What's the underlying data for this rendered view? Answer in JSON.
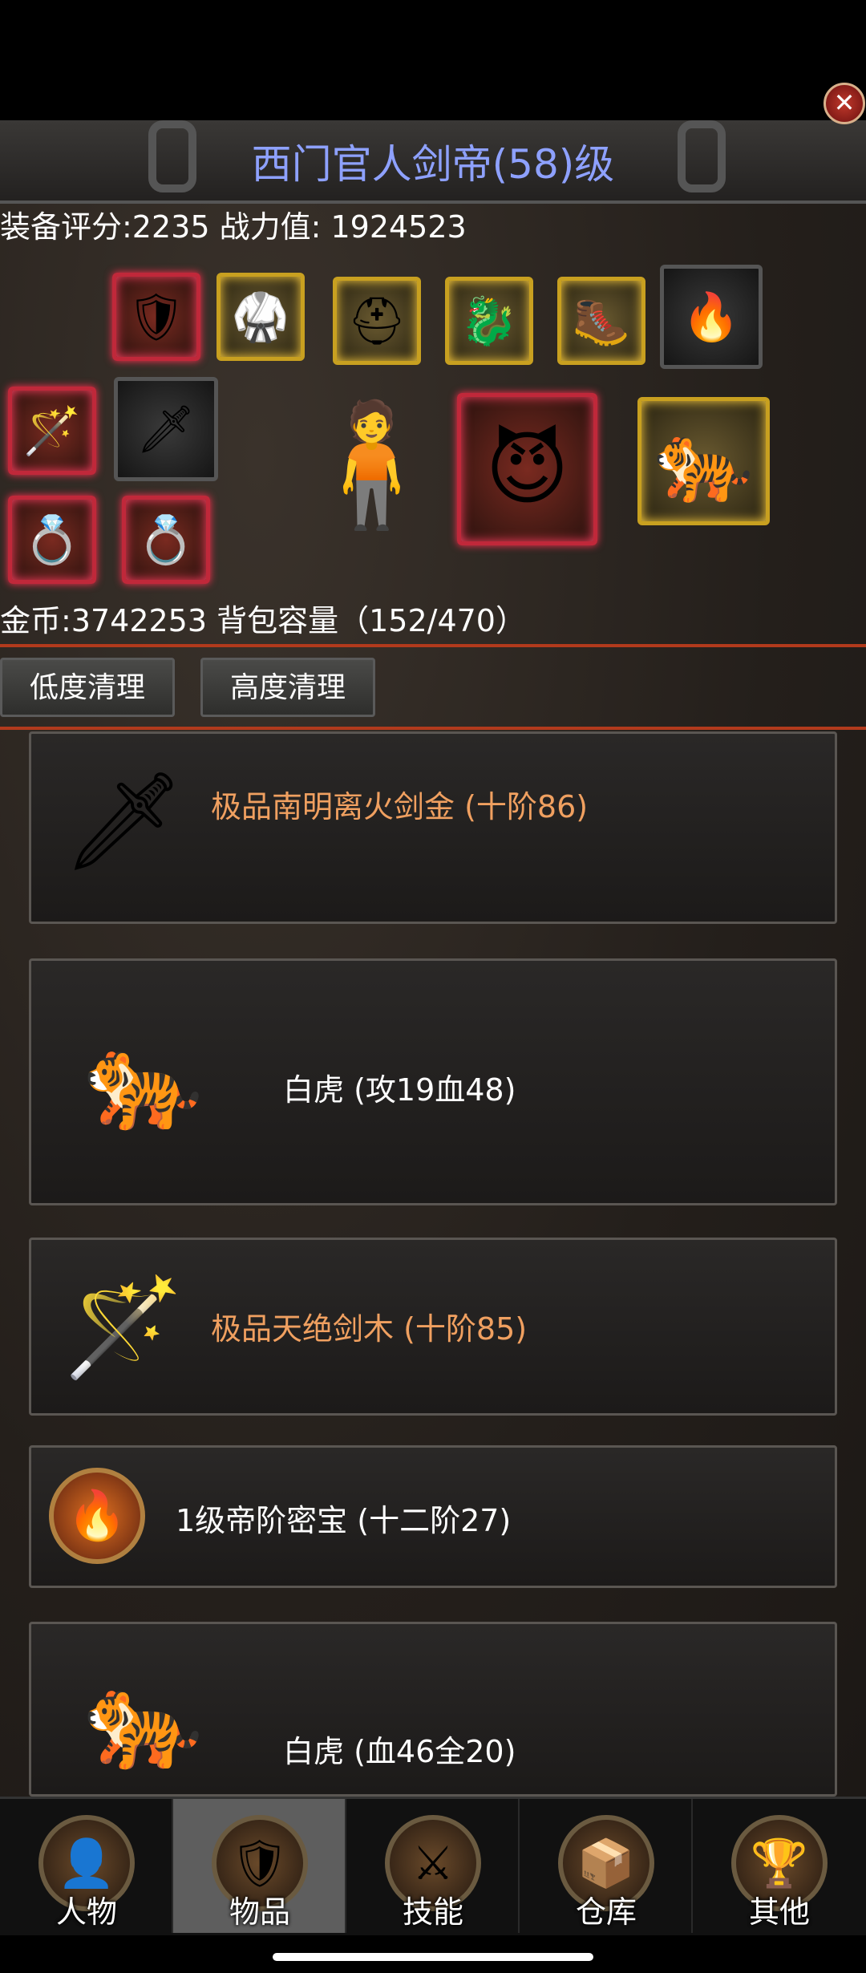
{
  "header": {
    "title": "西门官人剑帝(58)级",
    "close_symbol": "✕"
  },
  "stats": {
    "equip_line": "装备评分:2235 战力值: 1924523",
    "gold_line": "金币:3742253 背包容量（152/470）"
  },
  "buttons": {
    "low_clean": "低度清理",
    "high_clean": "高度清理"
  },
  "items": [
    {
      "name": "极品南明离火剑金 (十阶86)",
      "color": "#f0a060",
      "icon": "🗡"
    },
    {
      "name": "白虎 (攻19血48)",
      "color": "#ffffff",
      "icon": "🐅"
    },
    {
      "name": "极品天绝剑木 (十阶85)",
      "color": "#f0a060",
      "icon": "🪄"
    },
    {
      "name": "1级帝阶密宝 (十二阶27)",
      "color": "#ffffff",
      "icon": "🔥"
    },
    {
      "name": "白虎 (血46全20)",
      "color": "#ffffff",
      "icon": "🐅"
    }
  ],
  "tabs": [
    {
      "label": "人物",
      "icon": "👤",
      "active": false
    },
    {
      "label": "物品",
      "icon": "🛡",
      "active": true
    },
    {
      "label": "技能",
      "icon": "⚔",
      "active": false
    },
    {
      "label": "仓库",
      "icon": "📦",
      "active": false
    },
    {
      "label": "其他",
      "icon": "🏆",
      "active": false
    }
  ],
  "equipment_slot_icons": [
    "🛡",
    "🥋",
    "⛑",
    "🐉",
    "🥾",
    "🔥",
    "🪄",
    "🗡",
    "💍",
    "💍",
    "😈",
    "🐅"
  ],
  "character_icon": "🧍",
  "colors": {
    "title": "#8ea1ff",
    "quality_orange": "#f0a060",
    "rare_border": "#c0283a"
  }
}
